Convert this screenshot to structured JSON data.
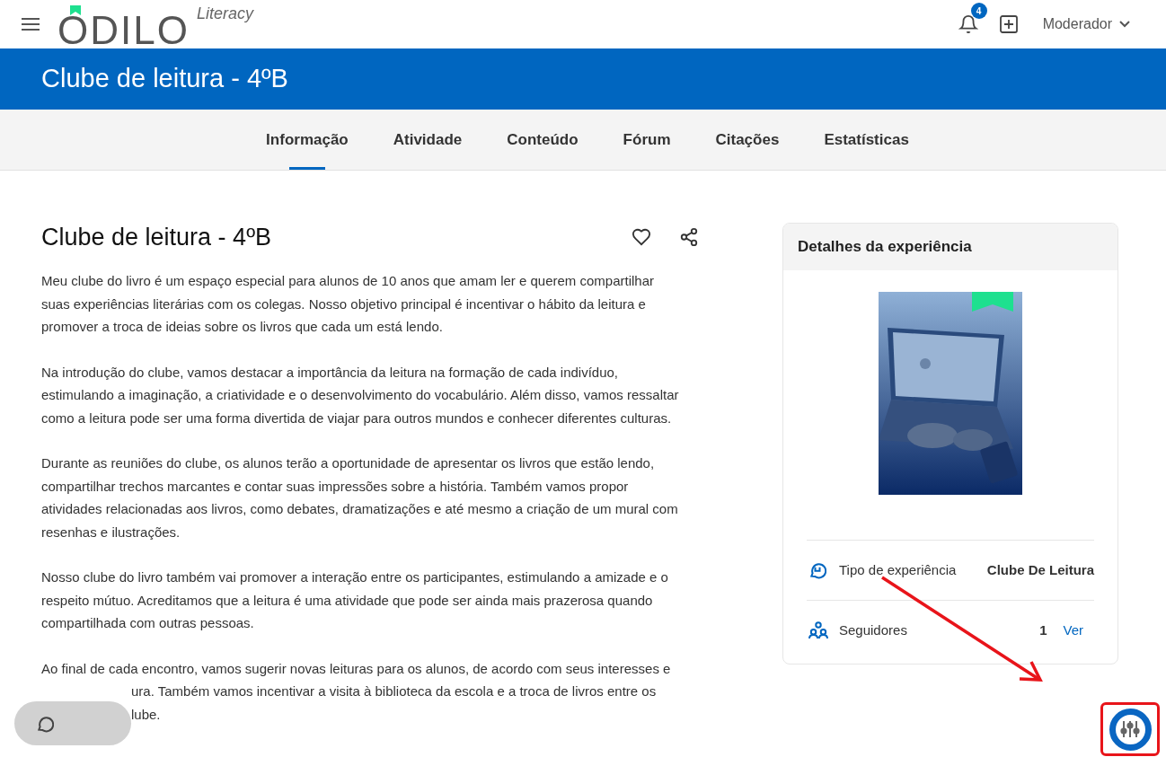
{
  "header": {
    "logo": "ODILO",
    "logo_suffix": "Literacy",
    "notifications": "4",
    "user": "Moderador"
  },
  "banner": {
    "title": "Clube de leitura - 4ºB"
  },
  "tabs": [
    {
      "label": "Informação",
      "selected": true
    },
    {
      "label": "Atividade",
      "selected": false
    },
    {
      "label": "Conteúdo",
      "selected": false
    },
    {
      "label": "Fórum",
      "selected": false
    },
    {
      "label": "Citações",
      "selected": false
    },
    {
      "label": "Estatísticas",
      "selected": false
    }
  ],
  "article": {
    "title": "Clube de leitura - 4ºB",
    "favorite": false,
    "paragraphs": [
      {
        "lines": [
          "Meu clube do livro é um espaço especial para alunos de 10 anos que amam ler e querem compartilhar",
          "suas experiências literárias com os colegas. Nosso objetivo principal é incentivar o hábito da leitura e",
          "promover a troca de ideias sobre os livros que cada um está lendo."
        ]
      },
      {
        "lines": [
          "Na introdução do clube, vamos destacar a importância da leitura na formação de cada indivíduo,",
          "estimulando a imaginação, a criatividade e o desenvolvimento do vocabulário. Além disso, vamos ressaltar",
          "como a leitura pode ser uma forma divertida de viajar para outros mundos e conhecer diferentes culturas."
        ]
      },
      {
        "lines": [
          "Durante as reuniões do clube, os alunos terão a oportunidade de apresentar os livros que estão lendo,",
          "compartilhar trechos marcantes e contar suas impressões sobre a história. Também vamos propor",
          "atividades relacionadas aos livros, como debates, dramatizações e até mesmo a criação de um mural com",
          "resenhas e ilustrações."
        ]
      },
      {
        "lines": [
          "Nosso clube do livro também vai promover a interação entre os participantes, estimulando a amizade e o",
          "respeito mútuo. Acreditamos que a leitura é uma atividade que pode ser ainda mais prazerosa quando",
          "compartilhada com outras pessoas."
        ]
      }
    ],
    "covered_paragraph": {
      "first_line": "Ao final de cada encontro, vamos sugerir novas leituras para os alunos, de acordo com seus interesses e",
      "visible_rest": [
        "ura. Também vamos incentivar a visita à biblioteca da escola e a troca de livros entre os",
        "lube."
      ]
    }
  },
  "details": {
    "title": "Detalhes da experiência",
    "rows": [
      {
        "kind": "type",
        "label": "Tipo de experiência",
        "value": "Clube De Leitura"
      },
      {
        "kind": "followers",
        "label": "Seguidores",
        "value": "1",
        "link": "Ver"
      }
    ]
  }
}
